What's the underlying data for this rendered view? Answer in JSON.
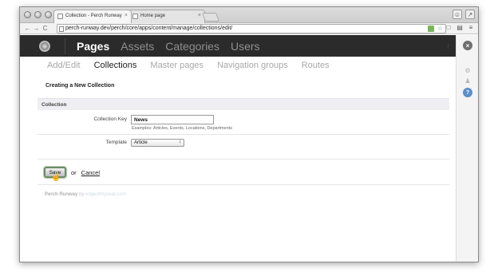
{
  "browser": {
    "tabs": [
      {
        "title": "Collection - Perch Runway",
        "close": "×"
      },
      {
        "title": "Home page",
        "close": "×"
      }
    ],
    "url": "perch-runway.dev/perch/core/apps/content/manage/collections/edit/",
    "nav": {
      "back": "←",
      "forward": "→",
      "reload": "C"
    }
  },
  "header": {
    "nav": [
      "Pages",
      "Assets",
      "Categories",
      "Users"
    ],
    "current": "Pages"
  },
  "subnav": {
    "items": [
      "Add/Edit",
      "Collections",
      "Master pages",
      "Navigation groups",
      "Routes"
    ],
    "current": "Collections"
  },
  "form": {
    "heading": "Creating a New Collection",
    "section": "Collection",
    "key_label": "Collection Key",
    "key_value": "News",
    "key_hint": "Examples: Articles, Events, Locations, Departments",
    "template_label": "Template",
    "template_value": "Article",
    "save_label": "Save",
    "or_text": "or",
    "cancel_label": "Cancel"
  },
  "footer": {
    "brand": "Perch Runway",
    "by": "by",
    "site": "edgeofmyseat.com"
  },
  "colors": {
    "header_bg": "#2b2b2b",
    "section_bg": "#efeef3",
    "help_blue": "#5a8fc9"
  }
}
